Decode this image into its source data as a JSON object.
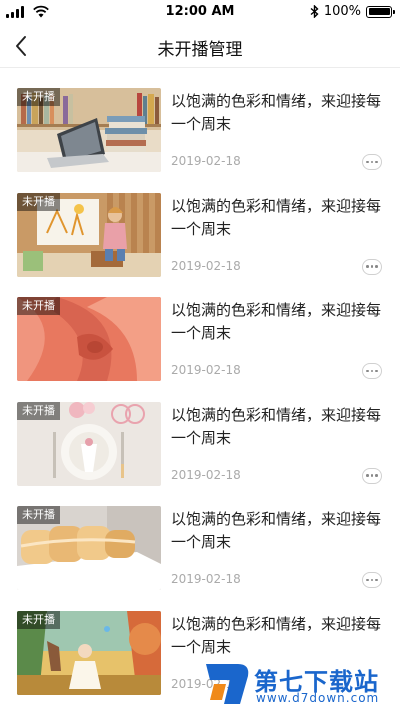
{
  "status_bar": {
    "time": "12:00 AM",
    "battery": "100%"
  },
  "nav": {
    "title": "未开播管理"
  },
  "items": [
    {
      "badge": "未开播",
      "title": "以饱满的色彩和情绪，来迎接每一个周末",
      "date": "2019-02-18",
      "thumb": "laptop-bookshelf"
    },
    {
      "badge": "未开播",
      "title": "以饱满的色彩和情绪，来迎接每一个周末",
      "date": "2019-02-18",
      "thumb": "girl-painting"
    },
    {
      "badge": "未开播",
      "title": "以饱满的色彩和情绪，来迎接每一个周末",
      "date": "2019-02-18",
      "thumb": "rose-closeup"
    },
    {
      "badge": "未开播",
      "title": "以饱满的色彩和情绪，来迎接每一个周末",
      "date": "2019-02-18",
      "thumb": "table-setting"
    },
    {
      "badge": "未开播",
      "title": "以饱满的色彩和情绪，来迎接每一个周末",
      "date": "2019-02-18",
      "thumb": "cake-roll"
    },
    {
      "badge": "未开播",
      "title": "以饱满的色彩和情绪，来迎接每一个周末",
      "date": "2019-02-18",
      "thumb": "forest-illustration"
    }
  ],
  "watermark": {
    "name": "第七下载站",
    "url": "www.d7down.com"
  }
}
